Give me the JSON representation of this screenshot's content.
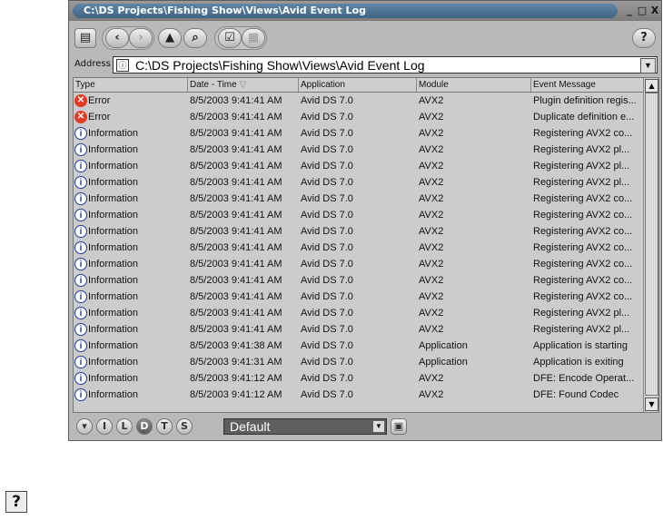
{
  "window": {
    "title": "C:\\DS Projects\\Fishing Show\\Views\\Avid Event Log",
    "controls": {
      "minimize": "_",
      "maximize": "□",
      "close": "X"
    }
  },
  "toolbar": {
    "icons": [
      "properties-icon",
      "back-icon",
      "forward-icon",
      "up-icon",
      "browse-icon",
      "check-icon",
      "grid-icon"
    ],
    "help_label": "?"
  },
  "address": {
    "label": "Address",
    "value": "C:\\DS Projects\\Fishing Show\\Views\\Avid Event Log"
  },
  "table": {
    "columns": [
      "Type",
      "Date - Time",
      "Application",
      "Module",
      "Event Message"
    ],
    "rows": [
      {
        "type": "Error",
        "icon": "error",
        "datetime": "8/5/2003 9:41:41 AM",
        "application": "Avid DS 7.0",
        "module": "AVX2",
        "message": "Plugin definition regis..."
      },
      {
        "type": "Error",
        "icon": "error",
        "datetime": "8/5/2003 9:41:41 AM",
        "application": "Avid DS 7.0",
        "module": "AVX2",
        "message": "Duplicate definition e..."
      },
      {
        "type": "Information",
        "icon": "info",
        "datetime": "8/5/2003 9:41:41 AM",
        "application": "Avid DS 7.0",
        "module": "AVX2",
        "message": "Registering AVX2 co..."
      },
      {
        "type": "Information",
        "icon": "info",
        "datetime": "8/5/2003 9:41:41 AM",
        "application": "Avid DS 7.0",
        "module": "AVX2",
        "message": "Registering AVX2 pl..."
      },
      {
        "type": "Information",
        "icon": "info",
        "datetime": "8/5/2003 9:41:41 AM",
        "application": "Avid DS 7.0",
        "module": "AVX2",
        "message": "Registering AVX2 pl..."
      },
      {
        "type": "Information",
        "icon": "info",
        "datetime": "8/5/2003 9:41:41 AM",
        "application": "Avid DS 7.0",
        "module": "AVX2",
        "message": "Registering AVX2 pl..."
      },
      {
        "type": "Information",
        "icon": "info",
        "datetime": "8/5/2003 9:41:41 AM",
        "application": "Avid DS 7.0",
        "module": "AVX2",
        "message": "Registering AVX2 co..."
      },
      {
        "type": "Information",
        "icon": "info",
        "datetime": "8/5/2003 9:41:41 AM",
        "application": "Avid DS 7.0",
        "module": "AVX2",
        "message": "Registering AVX2 co..."
      },
      {
        "type": "Information",
        "icon": "info",
        "datetime": "8/5/2003 9:41:41 AM",
        "application": "Avid DS 7.0",
        "module": "AVX2",
        "message": "Registering AVX2 co..."
      },
      {
        "type": "Information",
        "icon": "info",
        "datetime": "8/5/2003 9:41:41 AM",
        "application": "Avid DS 7.0",
        "module": "AVX2",
        "message": "Registering AVX2 co..."
      },
      {
        "type": "Information",
        "icon": "info",
        "datetime": "8/5/2003 9:41:41 AM",
        "application": "Avid DS 7.0",
        "module": "AVX2",
        "message": "Registering AVX2 co..."
      },
      {
        "type": "Information",
        "icon": "info",
        "datetime": "8/5/2003 9:41:41 AM",
        "application": "Avid DS 7.0",
        "module": "AVX2",
        "message": "Registering AVX2 co..."
      },
      {
        "type": "Information",
        "icon": "info",
        "datetime": "8/5/2003 9:41:41 AM",
        "application": "Avid DS 7.0",
        "module": "AVX2",
        "message": "Registering AVX2 co..."
      },
      {
        "type": "Information",
        "icon": "info",
        "datetime": "8/5/2003 9:41:41 AM",
        "application": "Avid DS 7.0",
        "module": "AVX2",
        "message": "Registering AVX2 pl..."
      },
      {
        "type": "Information",
        "icon": "info",
        "datetime": "8/5/2003 9:41:41 AM",
        "application": "Avid DS 7.0",
        "module": "AVX2",
        "message": "Registering AVX2 pl..."
      },
      {
        "type": "Information",
        "icon": "info",
        "datetime": "8/5/2003 9:41:38 AM",
        "application": "Avid DS 7.0",
        "module": "Application",
        "message": "Application is starting"
      },
      {
        "type": "Information",
        "icon": "info",
        "datetime": "8/5/2003 9:41:31 AM",
        "application": "Avid DS 7.0",
        "module": "Application",
        "message": "Application is exiting"
      },
      {
        "type": "Information",
        "icon": "info",
        "datetime": "8/5/2003 9:41:12 AM",
        "application": "Avid DS 7.0",
        "module": "AVX2",
        "message": "DFE: Encode Operat..."
      },
      {
        "type": "Information",
        "icon": "info",
        "datetime": "8/5/2003 9:41:12 AM",
        "application": "Avid DS 7.0",
        "module": "AVX2",
        "message": "DFE: Found Codec"
      }
    ]
  },
  "statusbar": {
    "filter_buttons": [
      "I",
      "L",
      "D",
      "T",
      "S"
    ],
    "active_filter": "D",
    "view_select": "Default"
  },
  "help_button": "?"
}
